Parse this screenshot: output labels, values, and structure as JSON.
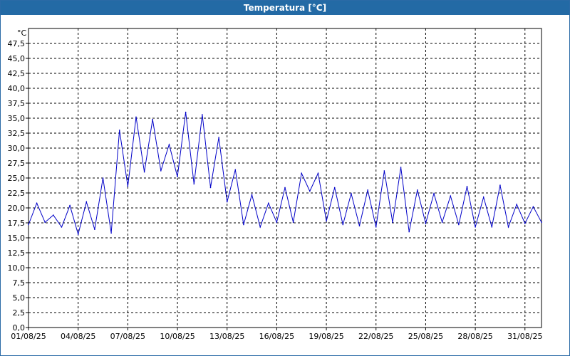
{
  "window": {
    "title": "Temperatura [°C]"
  },
  "chart_data": {
    "type": "line",
    "title": "Temperatura [°C]",
    "ylabel": "°C",
    "xlabel": "",
    "ylim": [
      0,
      50
    ],
    "xlim": [
      "01/08/25",
      "01/09/25"
    ],
    "y_ticks": [
      "0,0",
      "2,5",
      "5,0",
      "7,5",
      "10,0",
      "12,5",
      "15,0",
      "17,5",
      "20,0",
      "22,5",
      "25,0",
      "27,5",
      "30,0",
      "32,5",
      "35,0",
      "37,5",
      "40,0",
      "42,5",
      "45,0",
      "47,5"
    ],
    "x_ticks": [
      "01/08/25",
      "04/08/25",
      "07/08/25",
      "10/08/25",
      "13/08/25",
      "16/08/25",
      "19/08/25",
      "22/08/25",
      "25/08/25",
      "28/08/25",
      "31/08/25"
    ],
    "grid": true,
    "line_color": "#0000c8",
    "series": [
      {
        "x": [
          "01/08/25",
          "01/08/25 12:00",
          "02/08/25",
          "02/08/25 12:00",
          "03/08/25",
          "03/08/25 12:00",
          "04/08/25",
          "04/08/25 12:00",
          "05/08/25",
          "05/08/25 12:00",
          "06/08/25",
          "06/08/25 12:00",
          "07/08/25",
          "07/08/25 12:00",
          "08/08/25",
          "08/08/25 12:00",
          "09/08/25",
          "09/08/25 12:00",
          "10/08/25",
          "10/08/25 12:00",
          "11/08/25",
          "11/08/25 12:00",
          "12/08/25",
          "12/08/25 12:00",
          "13/08/25",
          "13/08/25 12:00",
          "14/08/25",
          "14/08/25 12:00",
          "15/08/25",
          "15/08/25 12:00",
          "16/08/25",
          "16/08/25 12:00",
          "17/08/25",
          "17/08/25 12:00",
          "18/08/25",
          "18/08/25 12:00",
          "19/08/25",
          "19/08/25 12:00",
          "20/08/25",
          "20/08/25 12:00",
          "21/08/25",
          "21/08/25 12:00",
          "22/08/25",
          "22/08/25 12:00",
          "23/08/25",
          "23/08/25 12:00",
          "24/08/25",
          "24/08/25 12:00",
          "25/08/25",
          "25/08/25 12:00",
          "26/08/25",
          "26/08/25 12:00",
          "27/08/25",
          "27/08/25 12:00",
          "28/08/25",
          "28/08/25 12:00",
          "29/08/25",
          "29/08/25 12:00",
          "30/08/25",
          "30/08/25 12:00",
          "31/08/25",
          "31/08/25 12:00",
          "01/09/25"
        ],
        "values": [
          17.2,
          20.8,
          17.6,
          18.8,
          16.8,
          20.4,
          15.6,
          21.0,
          16.4,
          25.0,
          15.8,
          33.0,
          23.6,
          35.2,
          26.0,
          34.8,
          26.2,
          30.6,
          25.2,
          36.0,
          24.0,
          35.6,
          23.4,
          31.8,
          21.0,
          26.4,
          17.2,
          22.2,
          16.8,
          20.8,
          17.6,
          23.4,
          17.6,
          25.8,
          22.8,
          25.8,
          17.8,
          23.4,
          17.2,
          22.4,
          17.0,
          23.0,
          16.8,
          26.2,
          17.6,
          26.8,
          16.0,
          23.0,
          17.4,
          22.4,
          17.6,
          22.0,
          17.2,
          23.6,
          16.8,
          21.8,
          16.8,
          23.8,
          16.8,
          20.6,
          17.4,
          20.2,
          17.6
        ]
      }
    ]
  }
}
